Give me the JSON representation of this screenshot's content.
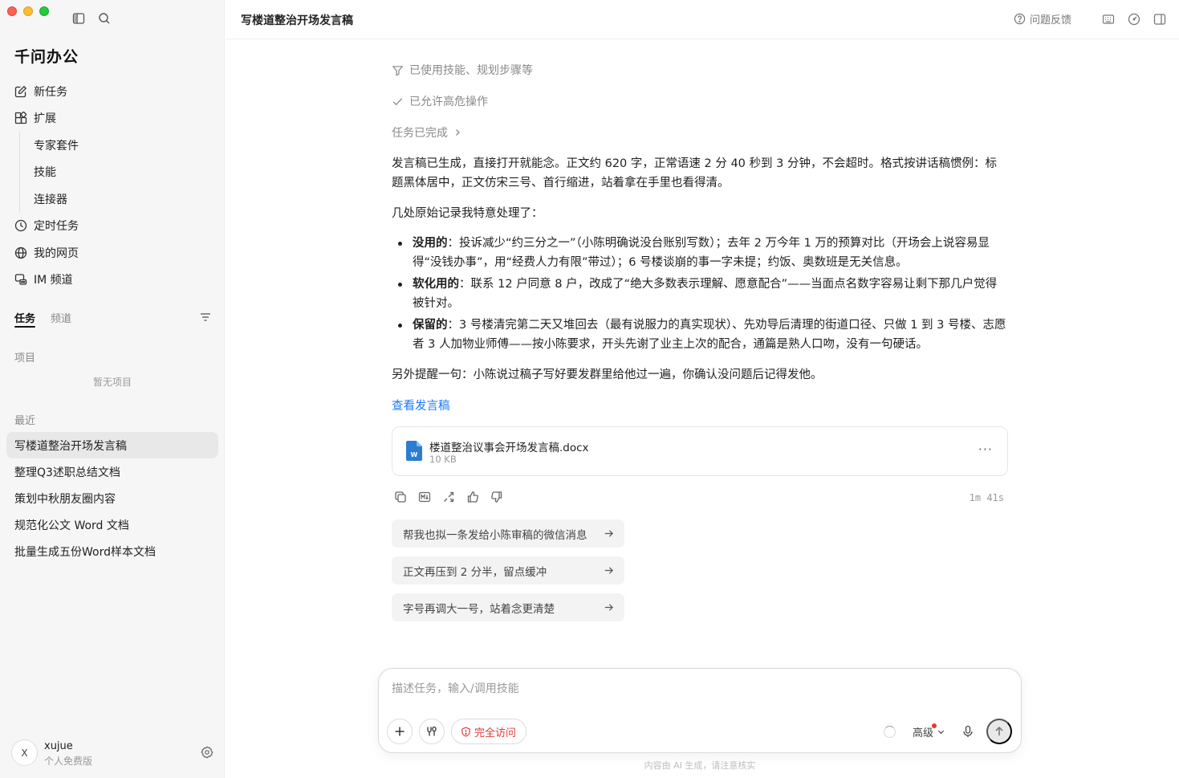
{
  "app": {
    "brand": "千问办公"
  },
  "sidebar": {
    "nav": [
      {
        "label": "新任务",
        "icon": "edit-icon"
      },
      {
        "label": "扩展",
        "icon": "extensions-icon"
      }
    ],
    "sub_nav": [
      {
        "label": "专家套件"
      },
      {
        "label": "技能"
      },
      {
        "label": "连接器"
      }
    ],
    "nav_after": [
      {
        "label": "定时任务",
        "icon": "clock-icon"
      },
      {
        "label": "我的网页",
        "icon": "globe-icon"
      },
      {
        "label": "IM 频道",
        "icon": "im-channel-icon"
      }
    ],
    "tabs": [
      {
        "label": "任务",
        "active": true
      },
      {
        "label": "频道",
        "active": false
      }
    ],
    "projects": {
      "label": "项目",
      "empty": "暂无项目"
    },
    "recent": {
      "label": "最近",
      "items": [
        {
          "label": "写楼道整治开场发言稿",
          "active": true
        },
        {
          "label": "整理Q3述职总结文档"
        },
        {
          "label": "策划中秋朋友圈内容"
        },
        {
          "label": "规范化公文 Word 文档"
        },
        {
          "label": "批量生成五份Word样本文档"
        }
      ]
    },
    "user": {
      "avatar": "X",
      "name": "xujue",
      "plan": "个人免费版"
    }
  },
  "header": {
    "title": "写楼道整治开场发言稿",
    "feedback": "问题反馈"
  },
  "conversation": {
    "status": {
      "skills": "已使用技能、规划步骤等",
      "allowed": "已允许高危操作",
      "done": "任务已完成"
    },
    "paragraph1": "发言稿已生成，直接打开就能念。正文约 620 字，正常语速 2 分 40 秒到 3 分钟，不会超时。格式按讲话稿惯例：标题黑体居中，正文仿宋三号、首行缩进，站着拿在手里也看得清。",
    "paragraph2": "几处原始记录我特意处理了：",
    "bullets": [
      {
        "head": "没用的",
        "text": "：投诉减少“约三分之一”（小陈明确说没台账别写数）；去年 2 万今年 1 万的预算对比（开场会上说容易显得“没钱办事”，用“经费人力有限”带过）；6 号楼谈崩的事一字未提；约饭、奥数班是无关信息。"
      },
      {
        "head": "软化用的",
        "text": "：联系 12 户同意 8 户，改成了“绝大多数表示理解、愿意配合”——当面点名数字容易让剩下那几户觉得被针对。"
      },
      {
        "head": "保留的",
        "text": "：3 号楼清完第二天又堆回去（最有说服力的真实现状）、先劝导后清理的街道口径、只做 1 到 3 号楼、志愿者 3 人加物业师傅——按小陈要求，开头先谢了业主上次的配合，通篇是熟人口吻，没有一句硬话。"
      }
    ],
    "paragraph3": "另外提醒一句：小陈说过稿子写好要发群里给他过一遍，你确认没问题后记得发他。",
    "link": "查看发言稿",
    "file": {
      "name": "楼道整治议事会开场发言稿.docx",
      "size": "10 KB",
      "more": "···",
      "type_letter": "W"
    },
    "elapsed": "1m 41s",
    "suggestions": [
      "帮我也拟一条发给小陈审稿的微信消息",
      "正文再压到 2 分半，留点缓冲",
      "字号再调大一号，站着念更清楚"
    ]
  },
  "composer": {
    "placeholder": "描述任务，输入/调用技能",
    "access": "完全访问",
    "mode": "高级",
    "disclaimer": "内容由 AI 生成，请注意核实"
  },
  "colors": {
    "accent": "#1677ff",
    "danger": "#e03a3a",
    "word_blue": "#2b7cd3"
  }
}
